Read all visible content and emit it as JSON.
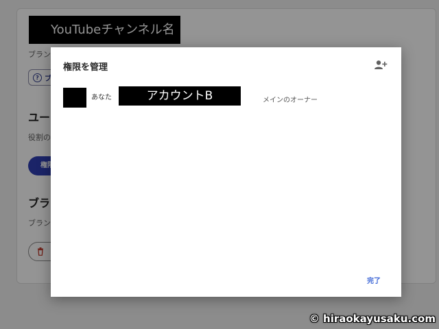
{
  "background": {
    "channel_name": "YouTubeチャンネル名",
    "brand_desc": "ブラン",
    "help_chip_label": "ブ",
    "users_heading": "ユー",
    "role_desc": "役割の",
    "permissions_button": "権限",
    "brand_heading2": "ブラ",
    "brand_desc2": "ブラン"
  },
  "dialog": {
    "title": "権限を管理",
    "add_user_icon": "person-add-icon",
    "user": {
      "you_label": "あなた",
      "account_name": "アカウントB",
      "role": "メインのオーナー"
    },
    "done_label": "完了"
  },
  "colors": {
    "accent": "#3a64d6",
    "primary_button": "#2f3fb3",
    "delete_icon": "#c0392b"
  },
  "watermark": "© hiraokayusaku.com"
}
